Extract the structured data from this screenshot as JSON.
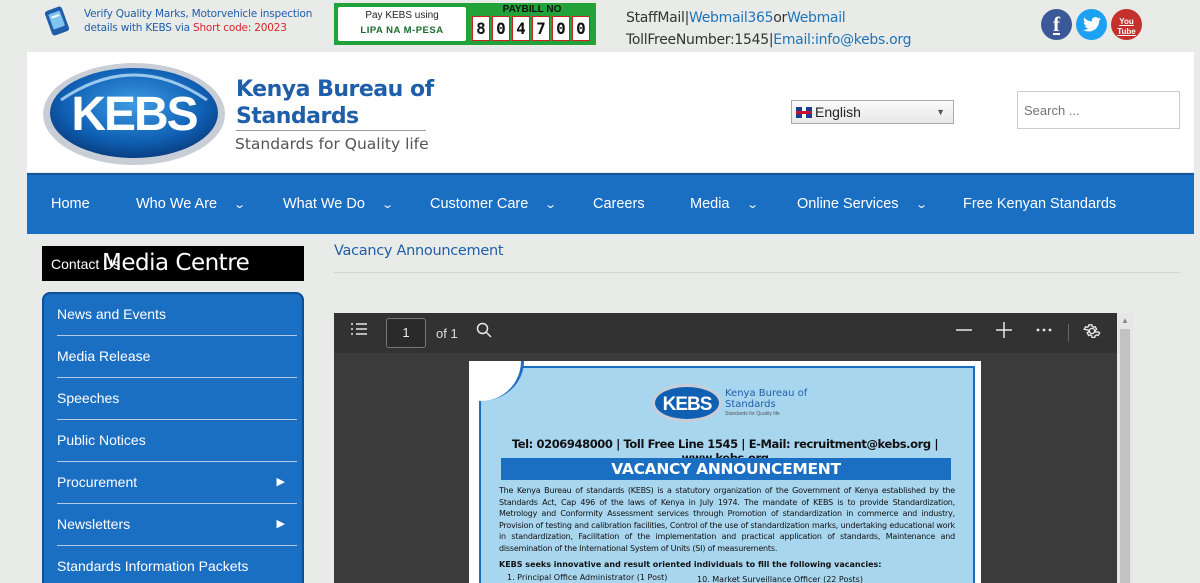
{
  "topbar": {
    "verify_line1": "Verify Quality Marks, Motorvehicle inspection",
    "verify_line2_prefix": "details with KEBS via ",
    "verify_short_code": "Short code: 20023",
    "pay_label": "Pay KEBS using",
    "pay_method": "LIPA NA M-PESA",
    "paybill_label": "PAYBILL NO",
    "paybill_digits": [
      "8",
      "0",
      "4",
      "7",
      "0",
      "0"
    ],
    "staffmail": "StaffMail",
    "sep1": "|",
    "webmail365": "Webmail365",
    "or": "or",
    "webmail": "Webmail",
    "tollfree": "TollFreeNumber:1545",
    "sep2": "|",
    "email": "Email:info@kebs.org",
    "social": {
      "facebook": "f",
      "twitter": "t",
      "youtube_top": "You",
      "youtube_bottom": "Tube"
    }
  },
  "header": {
    "logo_text": "KEBS",
    "brand_line1": "Kenya Bureau of",
    "brand_line2": "Standards",
    "tagline": "Standards for Quality life",
    "language": "English",
    "search_placeholder": "Search ..."
  },
  "nav": [
    {
      "label": "Home",
      "has_dropdown": false
    },
    {
      "label": "Who We Are",
      "has_dropdown": true
    },
    {
      "label": "What We Do",
      "has_dropdown": true
    },
    {
      "label": "Customer Care",
      "has_dropdown": true
    },
    {
      "label": "Careers",
      "has_dropdown": false
    },
    {
      "label": "Media",
      "has_dropdown": true
    },
    {
      "label": "Online Services",
      "has_dropdown": true
    },
    {
      "label": "Free Kenyan Standards",
      "has_dropdown": false
    }
  ],
  "sidebar": {
    "title_small": "Contact Us",
    "title_big": "Media Centre",
    "items": [
      {
        "label": "News and Events",
        "has_submenu": false
      },
      {
        "label": "Media Release",
        "has_submenu": false
      },
      {
        "label": "Speeches",
        "has_submenu": false
      },
      {
        "label": "Public Notices",
        "has_submenu": false
      },
      {
        "label": "Procurement",
        "has_submenu": true
      },
      {
        "label": "Newsletters",
        "has_submenu": true
      },
      {
        "label": "Standards Information Packets",
        "has_submenu": false
      }
    ]
  },
  "main": {
    "title": "Vacancy Announcement"
  },
  "pdf_viewer": {
    "page_number": "1",
    "page_total": "of 1",
    "icons": [
      "outline-icon",
      "search-icon",
      "zoom-out-icon",
      "zoom-in-icon",
      "more-icon",
      "settings-icon"
    ],
    "document": {
      "logo_text": "KEBS",
      "brand_line1": "Kenya Bureau of",
      "brand_line2": "Standards",
      "brand_sub": "Standards for Quality life",
      "contact_line": "Tel: 0206948000 | Toll Free Line 1545 | E-Mail: recruitment@kebs.org  | www.kebs.org",
      "heading": "VACANCY ANNOUNCEMENT",
      "body": "The Kenya Bureau of standards (KEBS) is a statutory organization of the Government of Kenya established by the Standards Act, Cap 496 of the laws of Kenya in July 1974. The mandate of KEBS is to provide Standardization, Metrology and Conformity Assessment services through Promotion of standardization in commerce and industry, Provision of testing and calibration facilities, Control of the use of standardization marks, undertaking educational work in standardization, Facilitation of the implementation and practical application of standards, Maintenance and dissemination of the International System of Units (SI) of measurements.",
      "seeks": "KEBS seeks innovative and result oriented individuals to fill the following vacancies:",
      "vacancy_1": "1. Principal Office Administrator (1 Post)",
      "vacancy_10": "10. Market Surveillance Officer (22 Posts)"
    }
  },
  "colors": {
    "brand_blue": "#1b6fc2",
    "link_blue": "#1f74b8",
    "mpesa_green": "#24a23a",
    "short_code_red": "#d9242c"
  }
}
